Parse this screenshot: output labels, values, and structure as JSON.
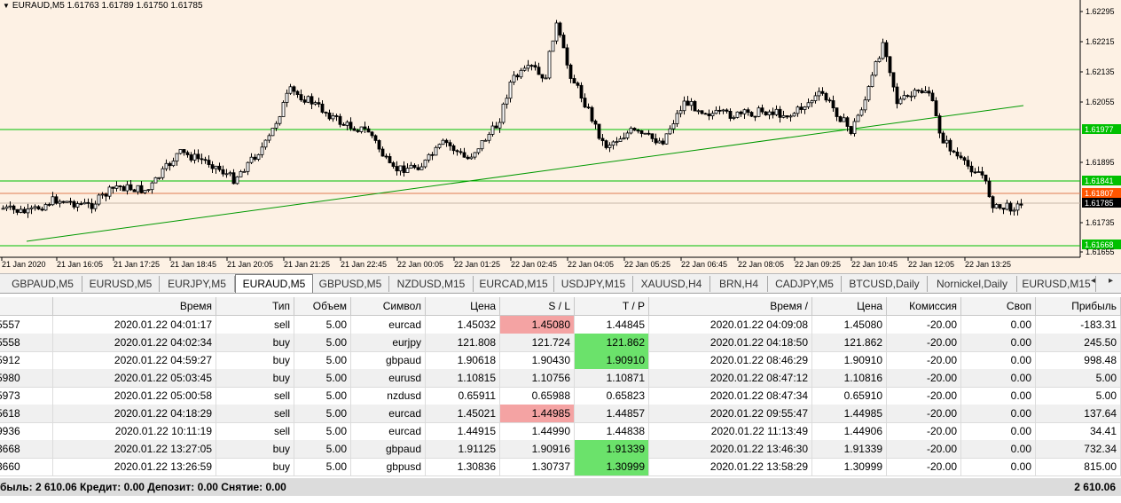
{
  "chart": {
    "symbol_label": "EURAUD,M5  1.61763 1.61789 1.61750 1.61785",
    "price_axis": [
      "1.62295",
      "1.62215",
      "1.62135",
      "1.62055",
      "1.61977",
      "1.61895",
      "1.61841",
      "1.61807",
      "1.61785",
      "1.61735",
      "1.61668",
      "1.61655"
    ],
    "time_axis": [
      "21 Jan 2020",
      "21 Jan 16:05",
      "21 Jan 17:25",
      "21 Jan 18:45",
      "21 Jan 20:05",
      "21 Jan 21:25",
      "21 Jan 22:45",
      "22 Jan 00:05",
      "22 Jan 01:25",
      "22 Jan 02:45",
      "22 Jan 04:05",
      "22 Jan 05:25",
      "22 Jan 06:45",
      "22 Jan 08:05",
      "22 Jan 09:25",
      "22 Jan 10:45",
      "22 Jan 12:05",
      "22 Jan 13:25"
    ],
    "colors": {
      "background": "#fdf1e4",
      "candles": "#000000",
      "level_lines": "#00c000",
      "trend_line": "#009900",
      "current_price": "#ff5500"
    }
  },
  "tabs": [
    "GBPAUD,M5",
    "EURUSD,M5",
    "EURJPY,M5",
    "EURAUD,M5",
    "GBPUSD,M5",
    "NZDUSD,M15",
    "EURCAD,M15",
    "USDJPY,M15",
    "XAUUSD,H4",
    "BRN,H4",
    "CADJPY,M5",
    "BTCUSD,Daily",
    "Nornickel,Daily",
    "EURUSD,M15"
  ],
  "active_tab": "EURAUD,M5",
  "table": {
    "headers": [
      "",
      "Время",
      "Тип",
      "Объем",
      "Символ",
      "Цена",
      "S / L",
      "T / P",
      "Время",
      "Цена",
      "Комиссия",
      "Своп",
      "Прибыль"
    ],
    "rows": [
      [
        "5557",
        "2020.01.22 04:01:17",
        "sell",
        "5.00",
        "eurcad",
        "1.45032",
        "1.45080",
        "1.44845",
        "2020.01.22 04:09:08",
        "1.45080",
        "-20.00",
        "0.00",
        "-183.31"
      ],
      [
        "5558",
        "2020.01.22 04:02:34",
        "buy",
        "5.00",
        "eurjpy",
        "121.808",
        "121.724",
        "121.862",
        "2020.01.22 04:18:50",
        "121.862",
        "-20.00",
        "0.00",
        "245.50"
      ],
      [
        "5912",
        "2020.01.22 04:59:27",
        "buy",
        "5.00",
        "gbpaud",
        "1.90618",
        "1.90430",
        "1.90910",
        "2020.01.22 08:46:29",
        "1.90910",
        "-20.00",
        "0.00",
        "998.48"
      ],
      [
        "5980",
        "2020.01.22 05:03:45",
        "buy",
        "5.00",
        "eurusd",
        "1.10815",
        "1.10756",
        "1.10871",
        "2020.01.22 08:47:12",
        "1.10816",
        "-20.00",
        "0.00",
        "5.00"
      ],
      [
        "5973",
        "2020.01.22 05:00:58",
        "sell",
        "5.00",
        "nzdusd",
        "0.65911",
        "0.65988",
        "0.65823",
        "2020.01.22 08:47:34",
        "0.65910",
        "-20.00",
        "0.00",
        "5.00"
      ],
      [
        "5618",
        "2020.01.22 04:18:29",
        "sell",
        "5.00",
        "eurcad",
        "1.45021",
        "1.44985",
        "1.44857",
        "2020.01.22 09:55:47",
        "1.44985",
        "-20.00",
        "0.00",
        "137.64"
      ],
      [
        "9936",
        "2020.01.22 10:11:19",
        "sell",
        "5.00",
        "eurcad",
        "1.44915",
        "1.44990",
        "1.44838",
        "2020.01.22 11:13:49",
        "1.44906",
        "-20.00",
        "0.00",
        "34.41"
      ],
      [
        "3668",
        "2020.01.22 13:27:05",
        "buy",
        "5.00",
        "gbpaud",
        "1.91125",
        "1.90916",
        "1.91339",
        "2020.01.22 13:46:30",
        "1.91339",
        "-20.00",
        "0.00",
        "732.34"
      ],
      [
        "3660",
        "2020.01.22 13:26:59",
        "buy",
        "5.00",
        "gbpusd",
        "1.30836",
        "1.30737",
        "1.30999",
        "2020.01.22 13:58:29",
        "1.30999",
        "-20.00",
        "0.00",
        "815.00"
      ]
    ],
    "highlights": {
      "0": {
        "6": "red"
      },
      "1": {
        "7": "green"
      },
      "2": {
        "7": "green"
      },
      "5": {
        "6": "red"
      },
      "7": {
        "7": "green"
      },
      "8": {
        "7": "green"
      }
    }
  },
  "footer": {
    "summary": "быль: 2 610.06  Кредит: 0.00  Депозит: 0.00  Снятие: 0.00",
    "total": "2 610.06"
  }
}
